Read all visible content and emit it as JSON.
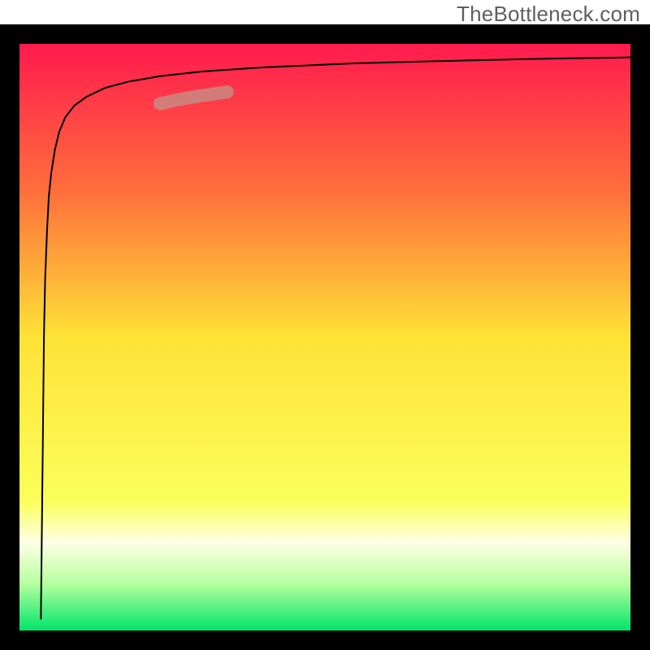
{
  "watermark": {
    "text": "TheBottleneck.com"
  },
  "chart_data": {
    "type": "line",
    "title": "",
    "xlabel": "",
    "ylabel": "",
    "xlim": [
      0,
      100
    ],
    "ylim": [
      0,
      100
    ],
    "background_gradient": {
      "type": "vertical",
      "stops": [
        {
          "position": 0.0,
          "color": "#FF1A4E"
        },
        {
          "position": 0.25,
          "color": "#FF6E3C"
        },
        {
          "position": 0.5,
          "color": "#FFE236"
        },
        {
          "position": 0.78,
          "color": "#FBFF5A"
        },
        {
          "position": 0.85,
          "color": "#FFFFE6"
        },
        {
          "position": 0.92,
          "color": "#B6FF9E"
        },
        {
          "position": 1.0,
          "color": "#00E56B"
        }
      ]
    },
    "frame": {
      "line_width": 24,
      "color": "#000000"
    },
    "series": [
      {
        "name": "bottleneck-curve",
        "color": "#000000",
        "line_width": 2,
        "x": [
          3.5,
          3.8,
          4.0,
          4.2,
          4.5,
          4.8,
          5.2,
          5.8,
          6.5,
          7.5,
          9.0,
          11.0,
          14.0,
          18.0,
          23.0,
          30.0,
          40.0,
          55.0,
          70.0,
          85.0,
          100.0
        ],
        "y": [
          2.0,
          30.0,
          50.0,
          60.0,
          68.0,
          74.0,
          78.0,
          82.0,
          85.0,
          87.5,
          89.5,
          91.0,
          92.5,
          93.6,
          94.5,
          95.3,
          96.0,
          96.7,
          97.1,
          97.45,
          97.7
        ]
      }
    ],
    "highlight": {
      "name": "highlighted-segment",
      "color": "#C98883",
      "line_width": 16,
      "opacity": 0.85,
      "x": [
        23.0,
        26.0,
        30.0,
        34.0
      ],
      "y": [
        89.8,
        90.5,
        91.2,
        91.8
      ]
    }
  }
}
